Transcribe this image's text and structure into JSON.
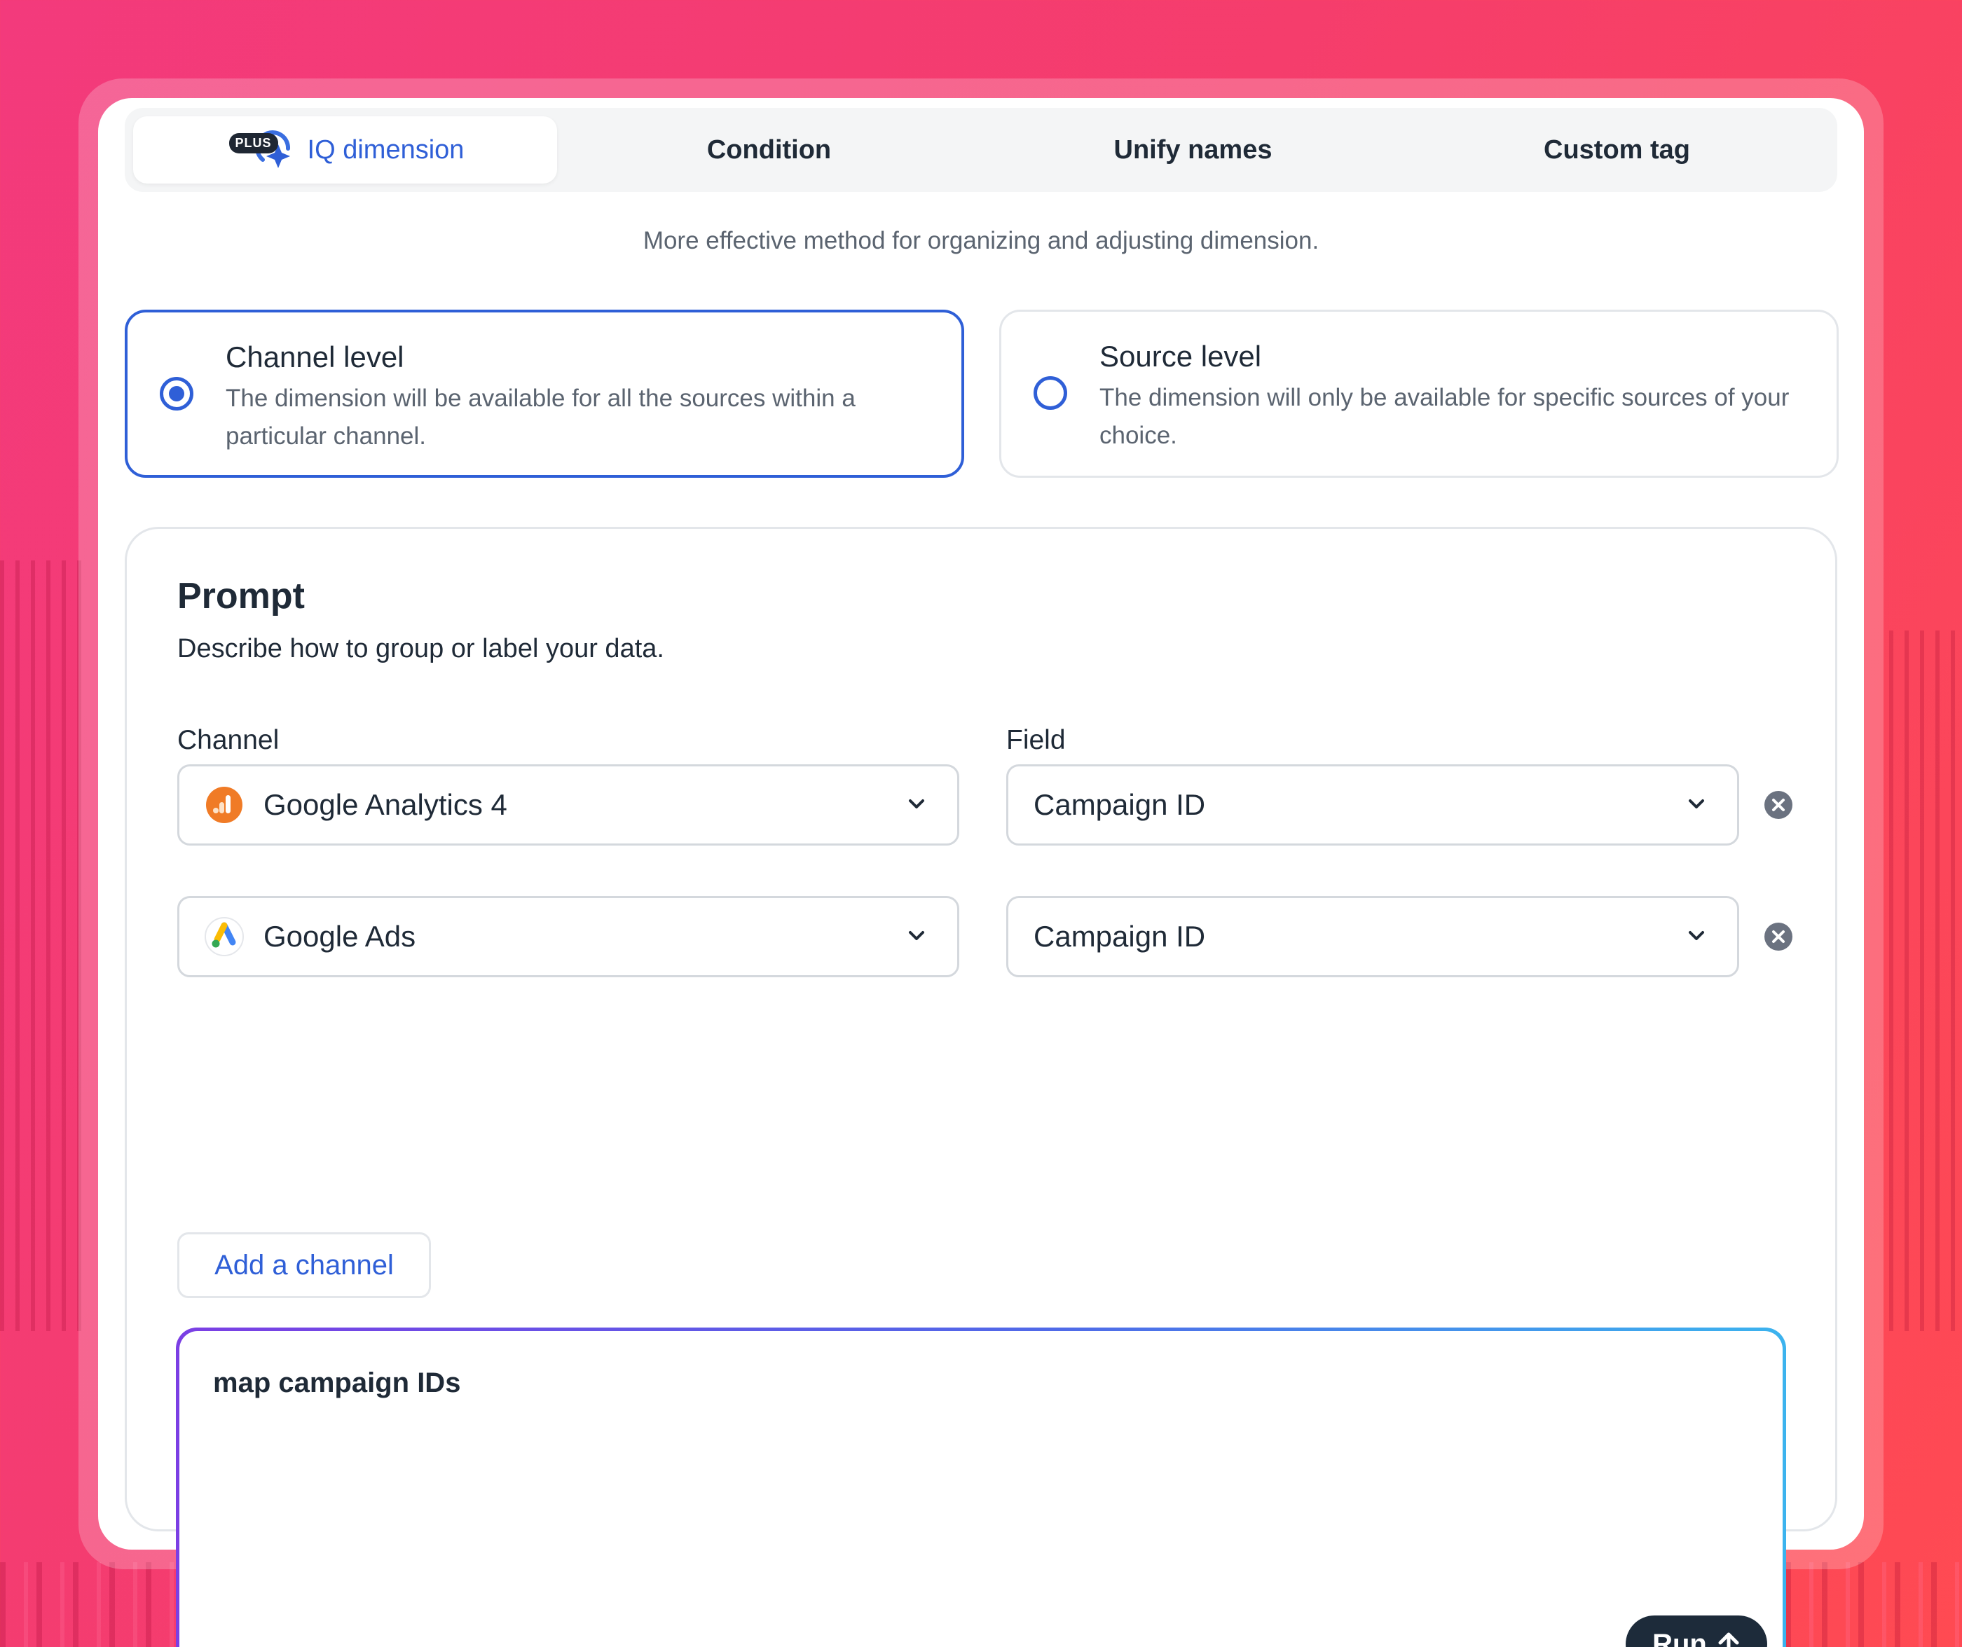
{
  "tabs": [
    {
      "label": "IQ dimension",
      "badge": "PLUS",
      "active": true
    },
    {
      "label": "Condition"
    },
    {
      "label": "Unify names"
    },
    {
      "label": "Custom tag"
    }
  ],
  "subtitle": "More effective method for organizing and adjusting dimension.",
  "options": [
    {
      "title": "Channel level",
      "description": "The dimension will be available for all the sources within a particular channel.",
      "selected": true
    },
    {
      "title": "Source level",
      "description": "The dimension will only be available for specific sources of your choice.",
      "selected": false
    }
  ],
  "prompt": {
    "title": "Prompt",
    "description": "Describe how to group or label your data.",
    "channel_label": "Channel",
    "field_label": "Field",
    "rows": [
      {
        "channel": "Google Analytics 4",
        "channel_icon": "google-analytics-icon",
        "field": "Campaign ID"
      },
      {
        "channel": "Google Ads",
        "channel_icon": "google-ads-icon",
        "field": "Campaign ID"
      }
    ],
    "add_channel_label": "Add a channel",
    "input_text": "map campaign IDs",
    "run_label": "Run"
  },
  "colors": {
    "accent": "#2f5fd7",
    "dark_button": "#1d2b3a",
    "background_pink": "#f53d6c"
  }
}
